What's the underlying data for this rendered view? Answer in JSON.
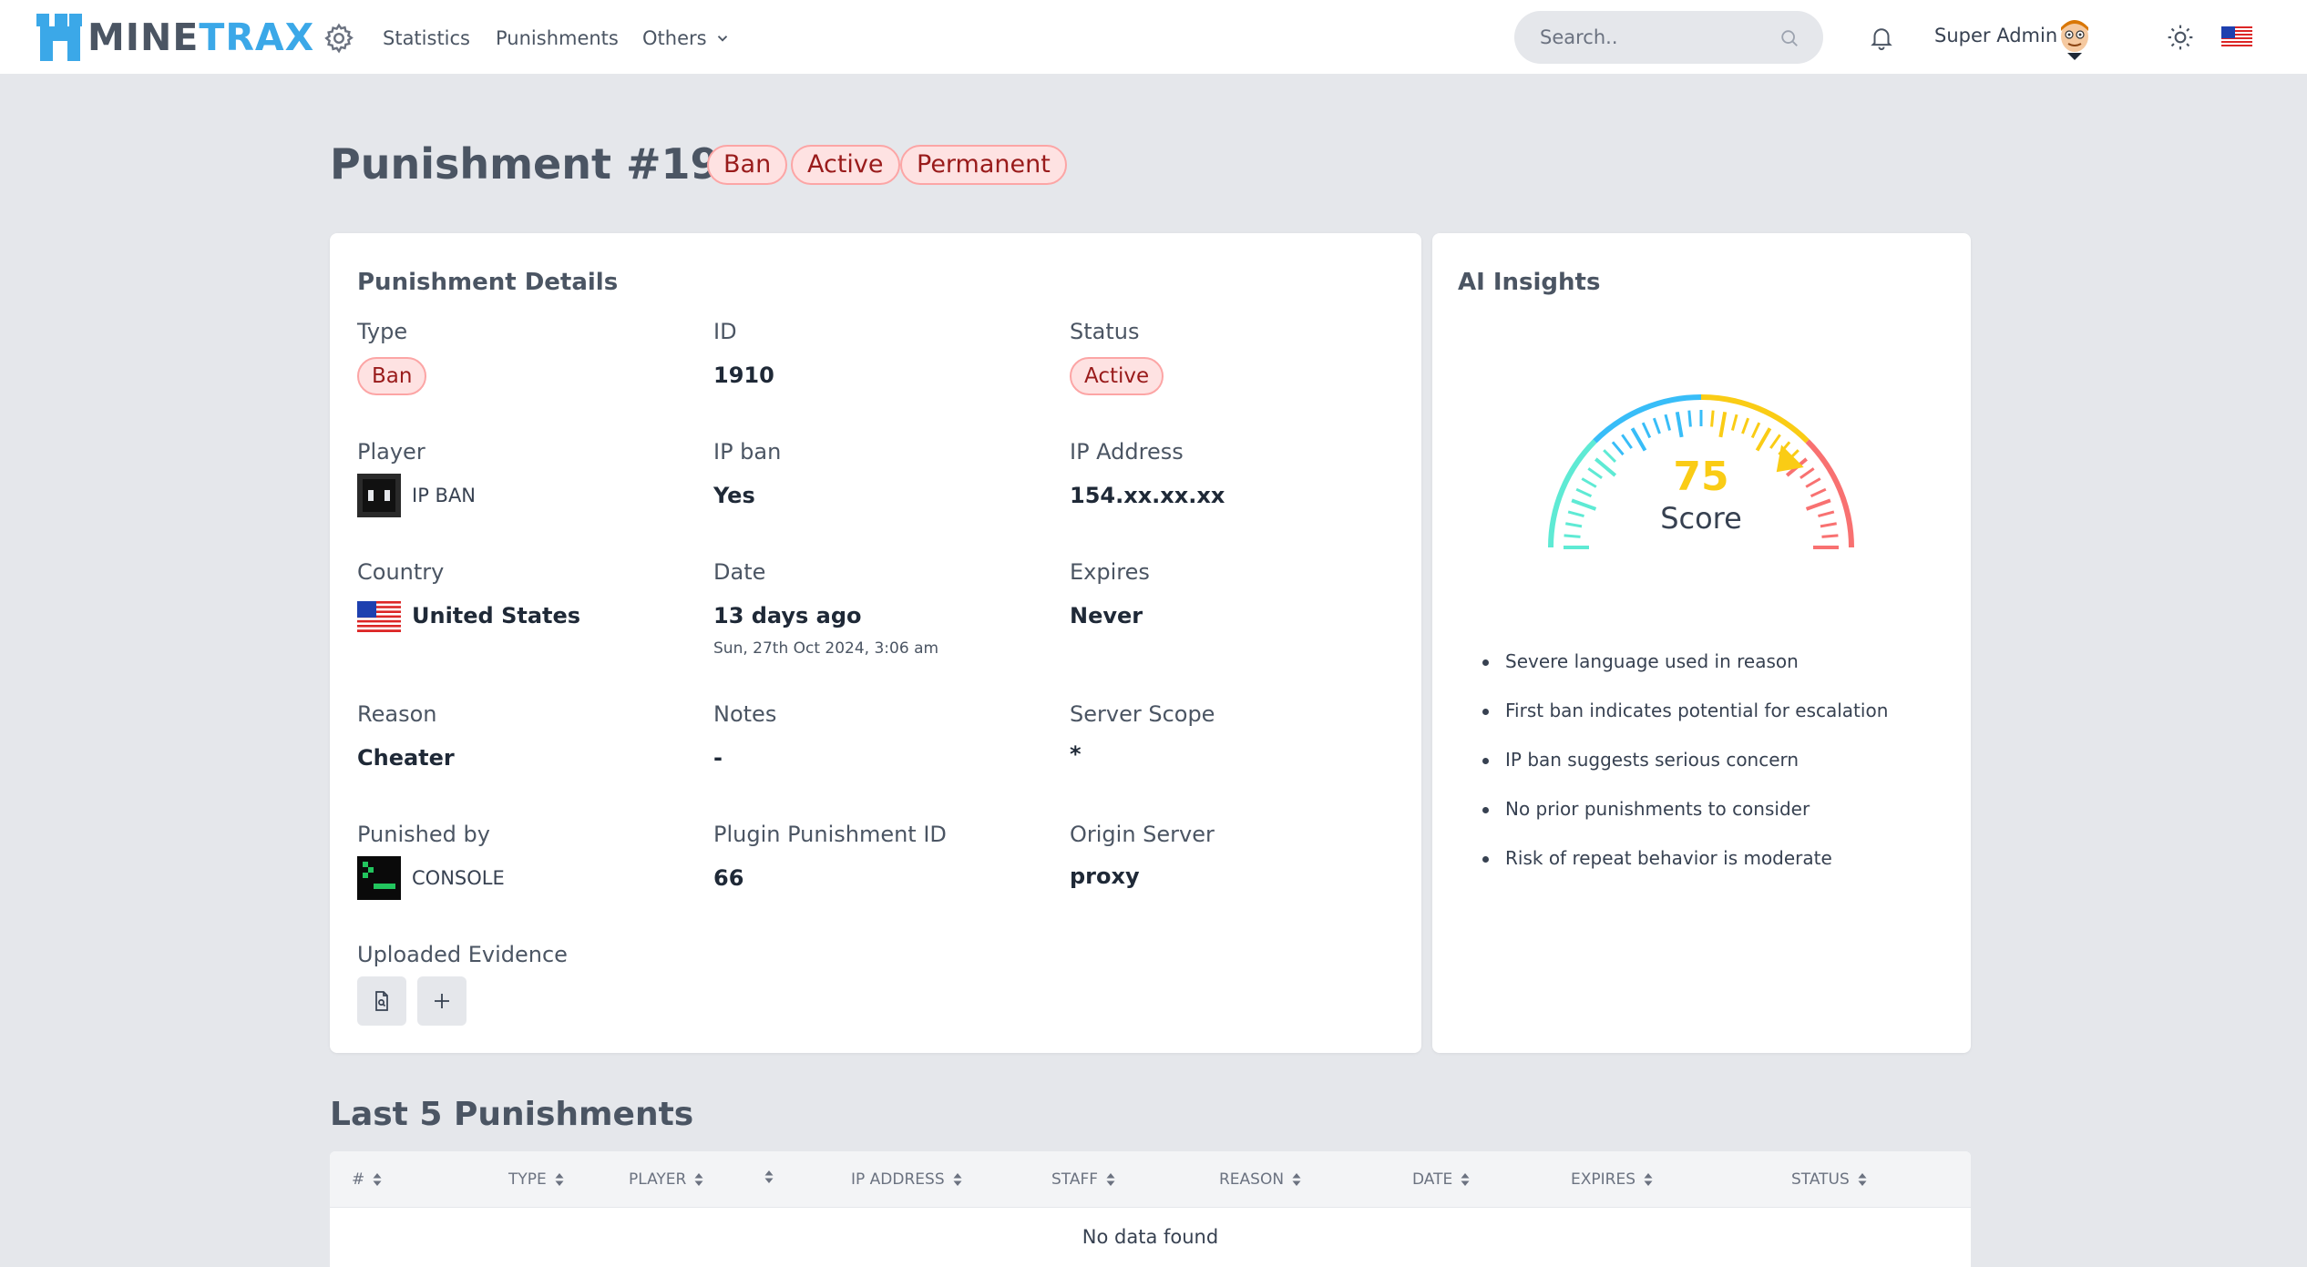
{
  "nav": {
    "brand_part1": "MINE",
    "brand_part2": "TRAX",
    "links": [
      "Statistics",
      "Punishments",
      "Others"
    ],
    "search_placeholder": "Search..",
    "user_name": "Super Admin"
  },
  "page": {
    "title": "Punishment #1910",
    "badges": [
      "Ban",
      "Active",
      "Permanent"
    ]
  },
  "details": {
    "card_title": "Punishment Details",
    "type_label": "Type",
    "type_value": "Ban",
    "id_label": "ID",
    "id_value": "1910",
    "status_label": "Status",
    "status_value": "Active",
    "player_label": "Player",
    "player_value": "IP BAN",
    "ipban_label": "IP ban",
    "ipban_value": "Yes",
    "ip_label": "IP Address",
    "ip_value": "154.xx.xx.xx",
    "country_label": "Country",
    "country_value": "United States",
    "date_label": "Date",
    "date_value": "13 days ago",
    "date_full": "Sun, 27th Oct 2024, 3:06 am",
    "expires_label": "Expires",
    "expires_value": "Never",
    "reason_label": "Reason",
    "reason_value": "Cheater",
    "notes_label": "Notes",
    "notes_value": "-",
    "scope_label": "Server Scope",
    "scope_value": "*",
    "punisher_label": "Punished by",
    "punisher_value": "CONSOLE",
    "plugin_label": "Plugin Punishment ID",
    "plugin_value": "66",
    "origin_label": "Origin Server",
    "origin_value": "proxy",
    "evidence_label": "Uploaded Evidence"
  },
  "ai": {
    "card_title": "AI Insights",
    "score": "75",
    "score_label": "Score",
    "score_fraction": 0.75,
    "insights": [
      "Severe language used in reason",
      "First ban indicates potential for escalation",
      "IP ban suggests serious concern",
      "No prior punishments to consider",
      "Risk of repeat behavior is moderate"
    ]
  },
  "history": {
    "title": "Last 5 Punishments",
    "columns": [
      "#",
      "",
      "TYPE",
      "PLAYER",
      "IP ADDRESS",
      "STAFF",
      "REASON",
      "DATE",
      "EXPIRES",
      "STATUS"
    ],
    "empty_message": "No data found"
  },
  "colors": {
    "brand_blue": "#3ba8e8",
    "badge_bg": "#fee2e2",
    "badge_text": "#991b1b",
    "gauge_green": "#5eead4",
    "gauge_blue": "#38bdf8",
    "gauge_yellow": "#facc15",
    "gauge_red": "#f87171"
  }
}
